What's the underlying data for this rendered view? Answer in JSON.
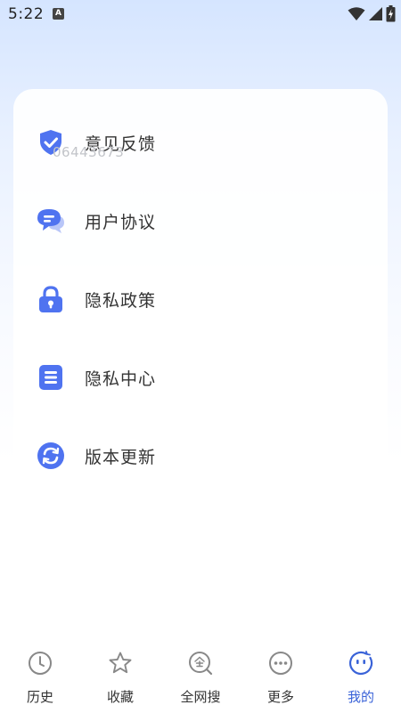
{
  "status": {
    "time": "5:22",
    "notification_letter": "A"
  },
  "watermark": "06443673",
  "menu": [
    {
      "label": "意见反馈",
      "icon": "shield-check-icon"
    },
    {
      "label": "用户协议",
      "icon": "chat-bubbles-icon"
    },
    {
      "label": "隐私政策",
      "icon": "padlock-icon"
    },
    {
      "label": "隐私中心",
      "icon": "list-document-icon"
    },
    {
      "label": "版本更新",
      "icon": "refresh-icon"
    }
  ],
  "tabs": [
    {
      "label": "历史",
      "icon": "clock-icon"
    },
    {
      "label": "收藏",
      "icon": "star-icon"
    },
    {
      "label": "全网搜",
      "icon": "search-all-icon"
    },
    {
      "label": "更多",
      "icon": "more-dots-icon"
    },
    {
      "label": "我的",
      "icon": "smiley-icon",
      "active": true
    }
  ],
  "colors": {
    "accent": "#3a63d8",
    "icon_blue": "#4f73f0",
    "text": "#333333"
  }
}
